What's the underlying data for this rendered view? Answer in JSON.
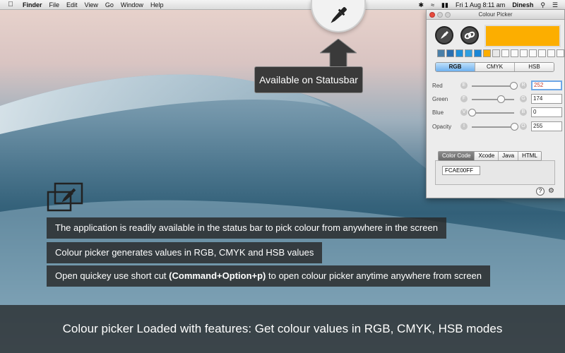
{
  "menubar": {
    "app": "Finder",
    "items": [
      "File",
      "Edit",
      "View",
      "Go",
      "Window",
      "Help"
    ],
    "datetime": "Fri 1 Aug  8:11 am",
    "user": "Dinesh"
  },
  "status_tip": "Available on Statusbar",
  "panel": {
    "title": "Colour Picker",
    "selected_color": "#FCAE00",
    "swatch_colors": [
      "#4a7fa8",
      "#2a6fb0",
      "#1f8fd8",
      "#2f9fe0",
      "#1a86d6",
      "#FCAE00",
      "#e8e8e8",
      "#fafafa",
      "#fafafa",
      "#fafafa",
      "#fafafa",
      "#fafafa",
      "#fafafa",
      "#fafafa"
    ],
    "modes": [
      "RGB",
      "CMYK",
      "HSB"
    ],
    "active_mode": "RGB",
    "sliders": [
      {
        "label": "Red",
        "left": "E",
        "right": "R",
        "value": "252",
        "level": 0.99
      },
      {
        "label": "Green",
        "left": "F",
        "right": "G",
        "value": "174",
        "level": 0.68
      },
      {
        "label": "Blue",
        "left": "V",
        "right": "B",
        "value": "0",
        "level": 0.0
      },
      {
        "label": "Opacity",
        "left": "I",
        "right": "O",
        "value": "255",
        "level": 1.0
      }
    ],
    "code_tabs": [
      "Color Code",
      "Xcode",
      "Java",
      "HTML"
    ],
    "active_code_tab": "Color Code",
    "color_code": "FCAE00FF",
    "help_label": "?"
  },
  "features": {
    "line1": "The application is readily available in the status bar to pick colour from anywhere in the screen",
    "line2": "Colour picker generates values in RGB, CMYK and HSB values",
    "line3_prefix": "Open quickey use short cut ",
    "line3_bold": "(Command+Option+p)",
    "line3_suffix": " to open colour picker anytime anywhere from screen"
  },
  "footer": "Colour picker Loaded with features: Get colour values in RGB, CMYK, HSB modes"
}
